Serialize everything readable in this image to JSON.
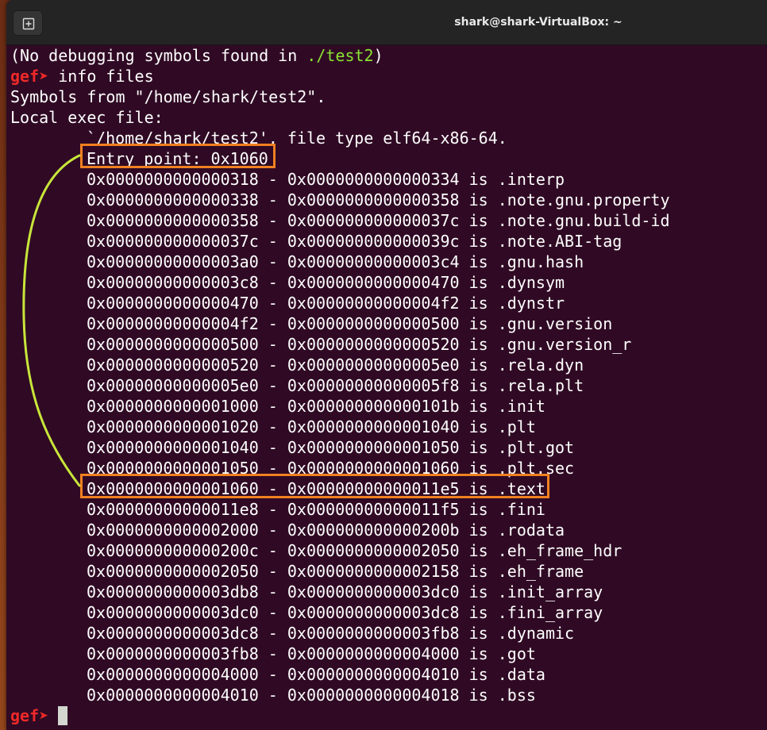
{
  "window": {
    "title": "shark@shark-VirtualBox: ~"
  },
  "terminal": {
    "prompt": "gef",
    "prompt_arrow": "➤",
    "line_nodebug_prefix": "(No debugging symbols found in ",
    "line_nodebug_path": "./test2",
    "line_nodebug_suffix": ")",
    "command": " info files",
    "symbols_line": "Symbols from \"/home/shark/test2\".",
    "local_exec": "Local exec file:",
    "file_type_line": "`/home/shark/test2', file type elf64-x86-64.",
    "entry_point": "Entry point: 0x1060",
    "sections": [
      "0x0000000000000318 - 0x0000000000000334 is .interp",
      "0x0000000000000338 - 0x0000000000000358 is .note.gnu.property",
      "0x0000000000000358 - 0x000000000000037c is .note.gnu.build-id",
      "0x000000000000037c - 0x000000000000039c is .note.ABI-tag",
      "0x00000000000003a0 - 0x00000000000003c4 is .gnu.hash",
      "0x00000000000003c8 - 0x0000000000000470 is .dynsym",
      "0x0000000000000470 - 0x00000000000004f2 is .dynstr",
      "0x00000000000004f2 - 0x0000000000000500 is .gnu.version",
      "0x0000000000000500 - 0x0000000000000520 is .gnu.version_r",
      "0x0000000000000520 - 0x00000000000005e0 is .rela.dyn",
      "0x00000000000005e0 - 0x00000000000005f8 is .rela.plt",
      "0x0000000000001000 - 0x000000000000101b is .init",
      "0x0000000000001020 - 0x0000000000001040 is .plt",
      "0x0000000000001040 - 0x0000000000001050 is .plt.got",
      "0x0000000000001050 - 0x0000000000001060 is .plt.sec",
      "0x0000000000001060 - 0x00000000000011e5 is .text",
      "0x00000000000011e8 - 0x00000000000011f5 is .fini",
      "0x0000000000002000 - 0x000000000000200b is .rodata",
      "0x000000000000200c - 0x0000000000002050 is .eh_frame_hdr",
      "0x0000000000002050 - 0x0000000000002158 is .eh_frame",
      "0x0000000000003db8 - 0x0000000000003dc0 is .init_array",
      "0x0000000000003dc0 - 0x0000000000003dc8 is .fini_array",
      "0x0000000000003dc8 - 0x0000000000003fb8 is .dynamic",
      "0x0000000000003fb8 - 0x0000000000004000 is .got",
      "0x0000000000004000 - 0x0000000000004010 is .data",
      "0x0000000000004010 - 0x0000000000004018 is .bss"
    ]
  },
  "colors": {
    "background": "#300a24",
    "text": "#ffffff",
    "prompt": "#ef2929",
    "path": "#8ae234",
    "highlight_box": "#f08020",
    "annotation_curve": "#c8e63a"
  }
}
